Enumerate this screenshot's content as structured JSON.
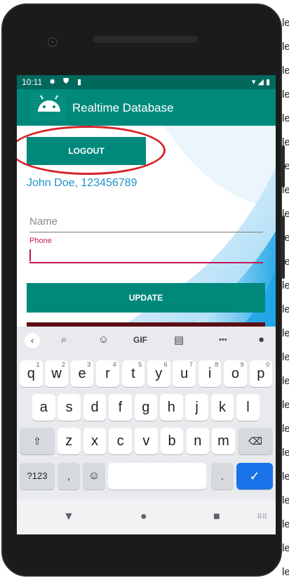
{
  "status_bar": {
    "time": "10:11",
    "icons": [
      "gear-icon",
      "shield-icon",
      "sim-icon"
    ],
    "right_icons": [
      "wifi-icon",
      "signal-icon",
      "battery-icon"
    ]
  },
  "app_bar": {
    "title": "Realtime Database",
    "icon": "android-icon"
  },
  "main": {
    "logout_label": "LOGOUT",
    "user_text": "John Doe, 123456789",
    "name_placeholder": "Name",
    "phone_label": "Phone",
    "phone_value": "",
    "update_label": "UPDATE"
  },
  "keyboard": {
    "toolbar": {
      "gif_label": "GIF",
      "more_label": "•••"
    },
    "rows": [
      [
        {
          "k": "q",
          "h": "1"
        },
        {
          "k": "w",
          "h": "2"
        },
        {
          "k": "e",
          "h": "3"
        },
        {
          "k": "r",
          "h": "4"
        },
        {
          "k": "t",
          "h": "5"
        },
        {
          "k": "y",
          "h": "6"
        },
        {
          "k": "u",
          "h": "7"
        },
        {
          "k": "i",
          "h": "8"
        },
        {
          "k": "o",
          "h": "9"
        },
        {
          "k": "p",
          "h": "0"
        }
      ],
      [
        {
          "k": "a"
        },
        {
          "k": "s"
        },
        {
          "k": "d"
        },
        {
          "k": "f"
        },
        {
          "k": "g"
        },
        {
          "k": "h"
        },
        {
          "k": "j"
        },
        {
          "k": "k"
        },
        {
          "k": "l"
        }
      ],
      [
        {
          "k": "z"
        },
        {
          "k": "x"
        },
        {
          "k": "c"
        },
        {
          "k": "v"
        },
        {
          "k": "b"
        },
        {
          "k": "n"
        },
        {
          "k": "m"
        }
      ]
    ],
    "numbers_label": "?123",
    "comma": ",",
    "period": "."
  },
  "colors": {
    "primary_dark": "#00695c",
    "primary": "#00897b",
    "accent": "#c2185b",
    "link_text": "#1f93c6",
    "highlight": "#d8232a",
    "enter_key": "#1a73e8"
  },
  "background_text": [
    "le",
    "le",
    "le",
    "le",
    "le",
    "le",
    "le",
    "le",
    "le",
    "le",
    "le",
    "le",
    "le",
    "le",
    "le",
    "le",
    "le",
    "le",
    "le",
    "le",
    "le",
    "le",
    "le",
    "le"
  ]
}
